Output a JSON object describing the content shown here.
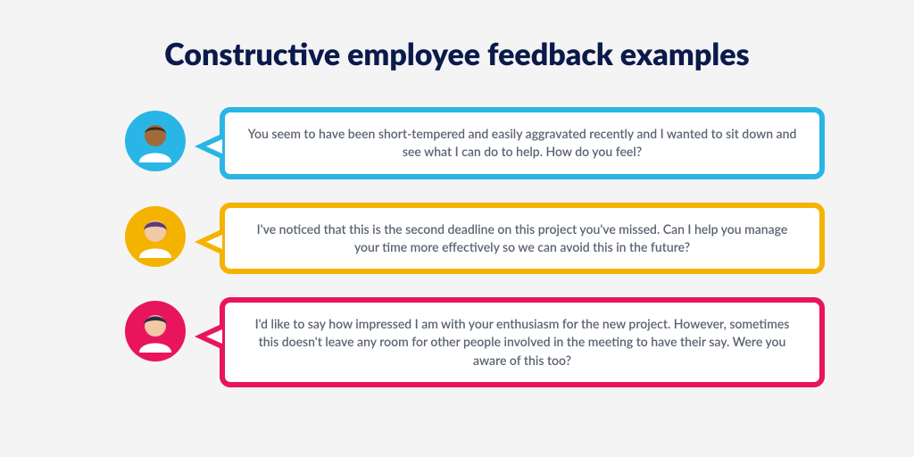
{
  "title": "Constructive employee feedback examples",
  "bubbles": [
    {
      "color": "blue",
      "avatar": {
        "skin": "#a06b3b",
        "hair": "#3a2a1c",
        "shirt": "#ffffff"
      },
      "text": "You seem to have been short-tempered and easily aggravated recently and I wanted to sit down and see what I can do to help. How do you feel?"
    },
    {
      "color": "orange",
      "avatar": {
        "skin": "#f2c9a5",
        "hair": "#5b3b7a",
        "shirt": "#ffffff"
      },
      "text": "I've noticed that this is the second deadline on this project you've missed. Can I help you manage your time more effectively so we can avoid this in the future?"
    },
    {
      "color": "pink",
      "avatar": {
        "skin": "#f2c9a5",
        "hair": "#2c2c46",
        "shirt": "#ffffff"
      },
      "text": "I'd like to say how impressed I am with your enthusiasm for the new project. However, sometimes this doesn't leave any room for other people involved in the meeting to have their say. Were you aware of this too?"
    }
  ]
}
